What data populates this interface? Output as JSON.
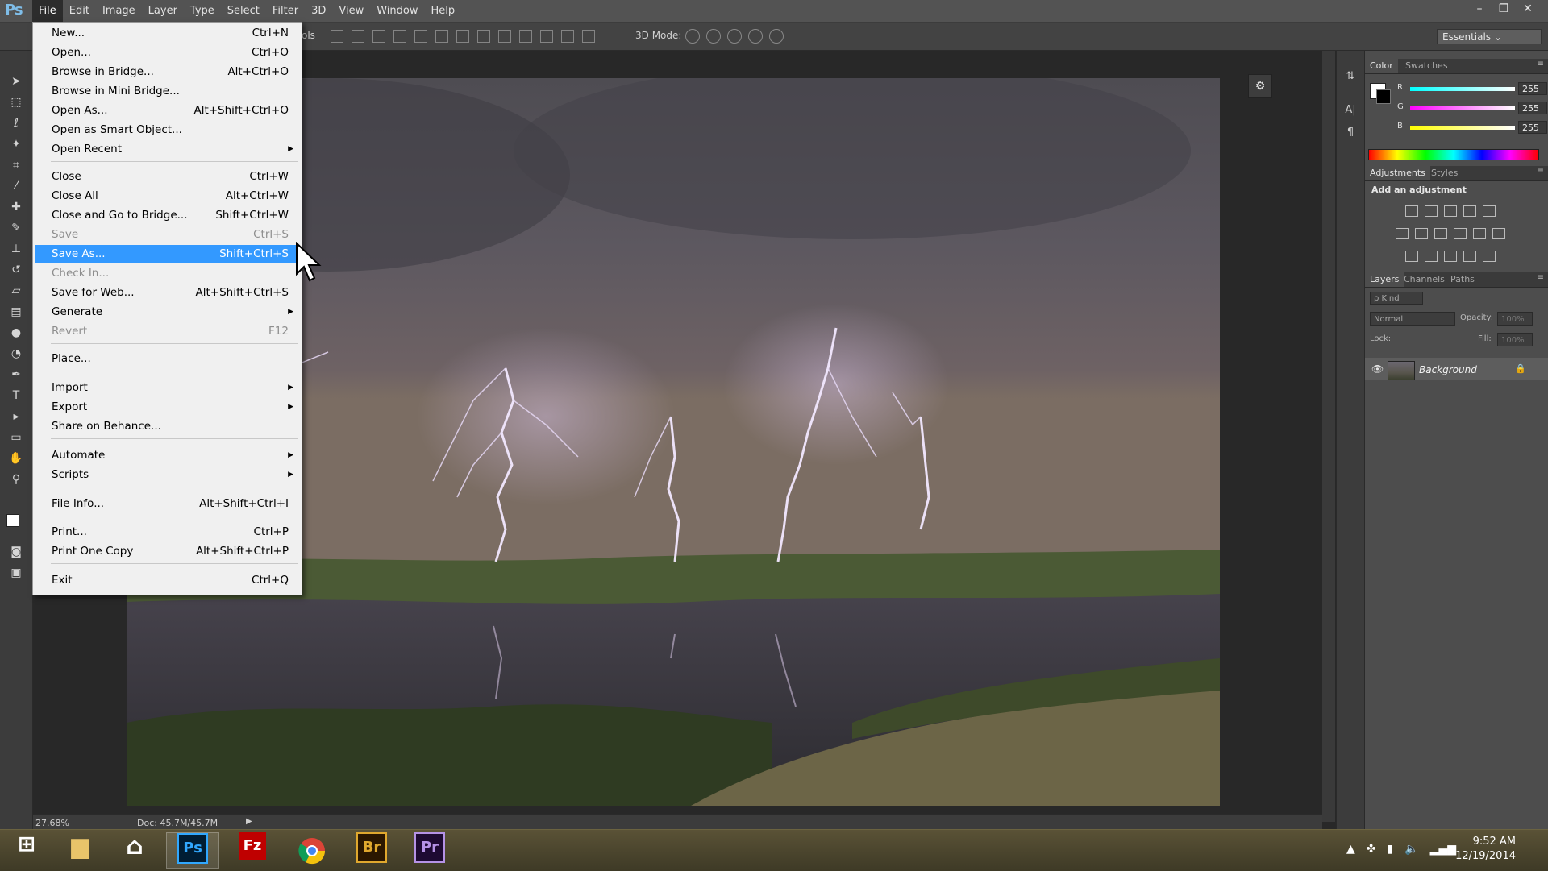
{
  "app": {
    "logo": "Ps"
  },
  "menubar": {
    "items": [
      "File",
      "Edit",
      "Image",
      "Layer",
      "Type",
      "Select",
      "Filter",
      "3D",
      "View",
      "Window",
      "Help"
    ]
  },
  "window_controls": [
    "–",
    "❐",
    "✕"
  ],
  "options_bar": {
    "label_fragment": "ols",
    "mode_3d": "3D Mode:"
  },
  "workspace": {
    "selected": "Essentials ⌄"
  },
  "file_menu": {
    "items": [
      {
        "label": "New...",
        "shortcut": "Ctrl+N"
      },
      {
        "label": "Open...",
        "shortcut": "Ctrl+O"
      },
      {
        "label": "Browse in Bridge...",
        "shortcut": "Alt+Ctrl+O"
      },
      {
        "label": "Browse in Mini Bridge...",
        "shortcut": ""
      },
      {
        "label": "Open As...",
        "shortcut": "Alt+Shift+Ctrl+O"
      },
      {
        "label": "Open as Smart Object...",
        "shortcut": ""
      },
      {
        "label": "Open Recent",
        "shortcut": ""
      },
      {
        "label": "Close",
        "shortcut": "Ctrl+W"
      },
      {
        "label": "Close All",
        "shortcut": "Alt+Ctrl+W"
      },
      {
        "label": "Close and Go to Bridge...",
        "shortcut": "Shift+Ctrl+W"
      },
      {
        "label": "Save",
        "shortcut": "Ctrl+S"
      },
      {
        "label": "Save As...",
        "shortcut": "Shift+Ctrl+S"
      },
      {
        "label": "Check In...",
        "shortcut": ""
      },
      {
        "label": "Save for Web...",
        "shortcut": "Alt+Shift+Ctrl+S"
      },
      {
        "label": "Generate",
        "shortcut": ""
      },
      {
        "label": "Revert",
        "shortcut": "F12"
      },
      {
        "label": "Place...",
        "shortcut": ""
      },
      {
        "label": "Import",
        "shortcut": ""
      },
      {
        "label": "Export",
        "shortcut": ""
      },
      {
        "label": "Share on Behance...",
        "shortcut": ""
      },
      {
        "label": "Automate",
        "shortcut": ""
      },
      {
        "label": "Scripts",
        "shortcut": ""
      },
      {
        "label": "File Info...",
        "shortcut": "Alt+Shift+Ctrl+I"
      },
      {
        "label": "Print...",
        "shortcut": "Ctrl+P"
      },
      {
        "label": "Print One Copy",
        "shortcut": "Alt+Shift+Ctrl+P"
      },
      {
        "label": "Exit",
        "shortcut": "Ctrl+Q"
      }
    ],
    "submenu_arrow": "▶"
  },
  "status": {
    "zoom": "27.68%",
    "doc": "Doc: 45.7M/45.7M",
    "arrow": "▶"
  },
  "color_panel": {
    "tabs": [
      "Color",
      "Swatches"
    ],
    "channels": [
      {
        "name": "R",
        "value": "255"
      },
      {
        "name": "G",
        "value": "255"
      },
      {
        "name": "B",
        "value": "255"
      }
    ]
  },
  "adjustments_panel": {
    "tabs": [
      "Adjustments",
      "Styles"
    ],
    "heading": "Add an adjustment"
  },
  "layers_panel": {
    "tabs": [
      "Layers",
      "Channels",
      "Paths"
    ],
    "kind": "ρ Kind",
    "blend_mode": "Normal",
    "opacity_label": "Opacity:",
    "opacity_value": "100%",
    "lock_label": "Lock:",
    "fill_label": "Fill:",
    "fill_value": "100%",
    "layer_name": "Background"
  },
  "taskbar": {
    "apps": [
      "Ps",
      "Fz",
      "Br",
      "Pr"
    ],
    "time": "9:52 AM",
    "date": "12/19/2014"
  },
  "colors": {
    "menu_highlight": "#3399ff",
    "ps_blue": "#7fbde8",
    "bridge": "#e0a82e",
    "premiere": "#b592e6"
  }
}
